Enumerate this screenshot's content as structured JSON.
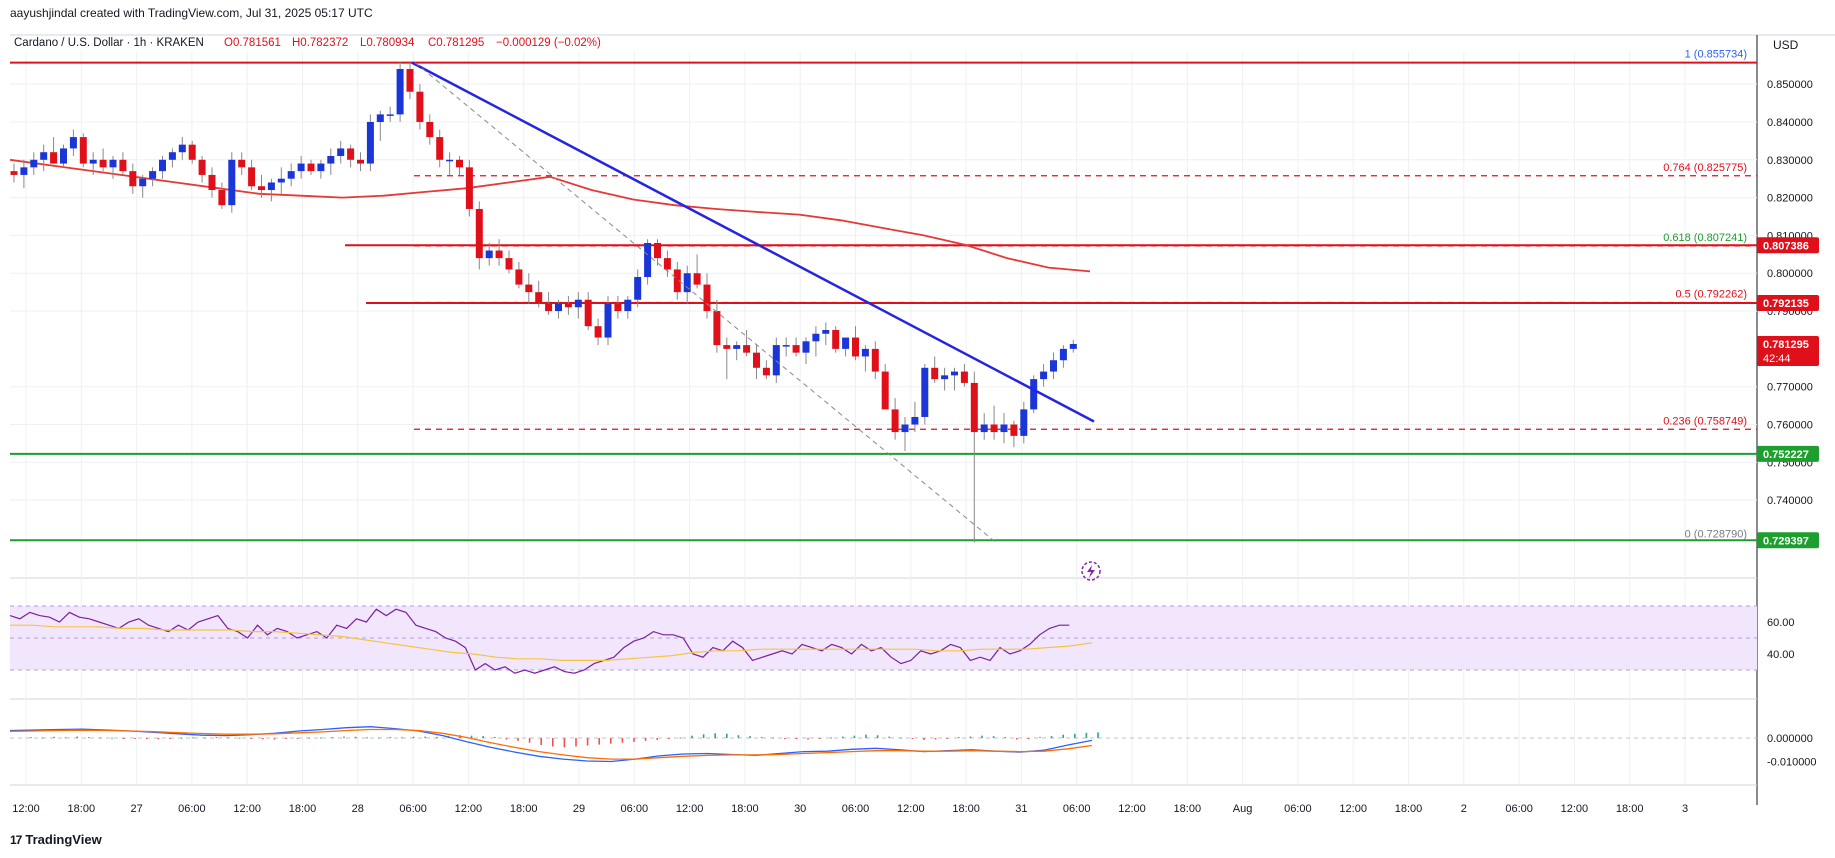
{
  "header": {
    "created_by": "aayushjindal created with TradingView.com, Jul 31, 2025 05:17 UTC"
  },
  "legend": {
    "symbol": "Cardano / U.S. Dollar · 1h · KRAKEN",
    "open": "O0.781561",
    "high": "H0.782372",
    "low": "L0.780934",
    "close": "C0.781295",
    "change": "−0.000129 (−0.02%)"
  },
  "currency": "USD",
  "footer": {
    "brand": "TradingView"
  },
  "colors": {
    "up": "#1a35d8",
    "down": "#e0101a",
    "ma": "#e53935",
    "trend": "#2524e0",
    "support": "#1e9e2e",
    "rsi_bg": "#f1e6fb",
    "rsi": "#7b1fa2",
    "rsi_ma": "#f5c542",
    "macd": "#2962ff",
    "signal": "#ff6d00"
  },
  "chart_data": {
    "type": "candlestick",
    "symbol": "ADAUSD",
    "timeframe": "1h",
    "ylim": [
      0.7255,
      0.8585
    ],
    "y_ticks": [
      "0.850000",
      "0.840000",
      "0.830000",
      "0.820000",
      "0.810000",
      "0.800000",
      "0.790000",
      "0.770000",
      "0.760000",
      "0.750000",
      "0.740000"
    ],
    "x_ticks": [
      "12:00",
      "18:00",
      "27",
      "06:00",
      "12:00",
      "18:00",
      "28",
      "06:00",
      "12:00",
      "18:00",
      "29",
      "06:00",
      "12:00",
      "18:00",
      "30",
      "06:00",
      "12:00",
      "18:00",
      "31",
      "06:00",
      "12:00",
      "18:00",
      "Aug",
      "06:00",
      "12:00",
      "18:00",
      "2",
      "06:00",
      "12:00",
      "18:00",
      "3"
    ],
    "candles_ohlc": [
      [
        0.827,
        0.829,
        0.824,
        0.826
      ],
      [
        0.826,
        0.83,
        0.8225,
        0.828
      ],
      [
        0.828,
        0.832,
        0.826,
        0.83
      ],
      [
        0.83,
        0.834,
        0.827,
        0.832
      ],
      [
        0.832,
        0.836,
        0.829,
        0.829
      ],
      [
        0.829,
        0.834,
        0.828,
        0.833
      ],
      [
        0.833,
        0.838,
        0.831,
        0.836
      ],
      [
        0.836,
        0.837,
        0.828,
        0.829
      ],
      [
        0.829,
        0.832,
        0.826,
        0.83
      ],
      [
        0.83,
        0.833,
        0.827,
        0.828
      ],
      [
        0.828,
        0.831,
        0.825,
        0.83
      ],
      [
        0.83,
        0.832,
        0.826,
        0.827
      ],
      [
        0.827,
        0.829,
        0.821,
        0.823
      ],
      [
        0.823,
        0.826,
        0.82,
        0.825
      ],
      [
        0.825,
        0.828,
        0.823,
        0.827
      ],
      [
        0.827,
        0.831,
        0.825,
        0.83
      ],
      [
        0.83,
        0.833,
        0.828,
        0.832
      ],
      [
        0.832,
        0.836,
        0.83,
        0.834
      ],
      [
        0.834,
        0.835,
        0.829,
        0.83
      ],
      [
        0.83,
        0.831,
        0.824,
        0.826
      ],
      [
        0.826,
        0.828,
        0.82,
        0.822
      ],
      [
        0.822,
        0.824,
        0.817,
        0.818
      ],
      [
        0.818,
        0.832,
        0.816,
        0.83
      ],
      [
        0.83,
        0.832,
        0.826,
        0.828
      ],
      [
        0.828,
        0.83,
        0.822,
        0.823
      ],
      [
        0.823,
        0.826,
        0.82,
        0.822
      ],
      [
        0.822,
        0.825,
        0.819,
        0.824
      ],
      [
        0.824,
        0.828,
        0.821,
        0.825
      ],
      [
        0.825,
        0.829,
        0.823,
        0.827
      ],
      [
        0.827,
        0.831,
        0.825,
        0.829
      ],
      [
        0.829,
        0.83,
        0.826,
        0.827
      ],
      [
        0.827,
        0.83,
        0.825,
        0.829
      ],
      [
        0.829,
        0.833,
        0.826,
        0.831
      ],
      [
        0.831,
        0.835,
        0.829,
        0.833
      ],
      [
        0.833,
        0.834,
        0.828,
        0.83
      ],
      [
        0.83,
        0.832,
        0.827,
        0.829
      ],
      [
        0.829,
        0.842,
        0.827,
        0.84
      ],
      [
        0.84,
        0.843,
        0.835,
        0.842
      ],
      [
        0.842,
        0.844,
        0.84,
        0.842
      ],
      [
        0.842,
        0.856,
        0.84,
        0.854
      ],
      [
        0.854,
        0.8557,
        0.846,
        0.848
      ],
      [
        0.848,
        0.85,
        0.838,
        0.84
      ],
      [
        0.84,
        0.842,
        0.834,
        0.836
      ],
      [
        0.836,
        0.838,
        0.828,
        0.83
      ],
      [
        0.83,
        0.832,
        0.826,
        0.83
      ],
      [
        0.83,
        0.831,
        0.826,
        0.828
      ],
      [
        0.828,
        0.83,
        0.815,
        0.817
      ],
      [
        0.817,
        0.819,
        0.801,
        0.804
      ],
      [
        0.804,
        0.808,
        0.802,
        0.806
      ],
      [
        0.806,
        0.809,
        0.802,
        0.804
      ],
      [
        0.804,
        0.806,
        0.8,
        0.801
      ],
      [
        0.801,
        0.803,
        0.796,
        0.797
      ],
      [
        0.797,
        0.8,
        0.792,
        0.795
      ],
      [
        0.795,
        0.798,
        0.791,
        0.792
      ],
      [
        0.792,
        0.795,
        0.789,
        0.79
      ],
      [
        0.79,
        0.793,
        0.788,
        0.792
      ],
      [
        0.792,
        0.794,
        0.789,
        0.791
      ],
      [
        0.791,
        0.795,
        0.788,
        0.793
      ],
      [
        0.793,
        0.795,
        0.785,
        0.786
      ],
      [
        0.786,
        0.788,
        0.781,
        0.783
      ],
      [
        0.783,
        0.794,
        0.781,
        0.792
      ],
      [
        0.792,
        0.794,
        0.788,
        0.79
      ],
      [
        0.79,
        0.794,
        0.788,
        0.793
      ],
      [
        0.793,
        0.801,
        0.791,
        0.799
      ],
      [
        0.799,
        0.809,
        0.797,
        0.808
      ],
      [
        0.808,
        0.809,
        0.802,
        0.804
      ],
      [
        0.804,
        0.806,
        0.799,
        0.801
      ],
      [
        0.801,
        0.803,
        0.793,
        0.795
      ],
      [
        0.795,
        0.802,
        0.792,
        0.8
      ],
      [
        0.8,
        0.805,
        0.796,
        0.797
      ],
      [
        0.797,
        0.8,
        0.788,
        0.79
      ],
      [
        0.79,
        0.793,
        0.779,
        0.781
      ],
      [
        0.781,
        0.783,
        0.772,
        0.78
      ],
      [
        0.78,
        0.782,
        0.777,
        0.781
      ],
      [
        0.781,
        0.785,
        0.778,
        0.779
      ],
      [
        0.779,
        0.781,
        0.772,
        0.775
      ],
      [
        0.775,
        0.777,
        0.772,
        0.773
      ],
      [
        0.773,
        0.783,
        0.771,
        0.781
      ],
      [
        0.781,
        0.783,
        0.778,
        0.781
      ],
      [
        0.781,
        0.783,
        0.778,
        0.779
      ],
      [
        0.779,
        0.783,
        0.776,
        0.782
      ],
      [
        0.782,
        0.786,
        0.778,
        0.784
      ],
      [
        0.784,
        0.787,
        0.781,
        0.785
      ],
      [
        0.785,
        0.786,
        0.779,
        0.78
      ],
      [
        0.78,
        0.783,
        0.778,
        0.783
      ],
      [
        0.783,
        0.786,
        0.777,
        0.778
      ],
      [
        0.778,
        0.781,
        0.774,
        0.78
      ],
      [
        0.78,
        0.782,
        0.772,
        0.774
      ],
      [
        0.774,
        0.776,
        0.766,
        0.764
      ],
      [
        0.764,
        0.767,
        0.756,
        0.758
      ],
      [
        0.758,
        0.762,
        0.753,
        0.76
      ],
      [
        0.76,
        0.766,
        0.758,
        0.762
      ],
      [
        0.762,
        0.776,
        0.76,
        0.775
      ],
      [
        0.775,
        0.778,
        0.771,
        0.772
      ],
      [
        0.772,
        0.775,
        0.769,
        0.773
      ],
      [
        0.773,
        0.775,
        0.769,
        0.774
      ],
      [
        0.774,
        0.776,
        0.77,
        0.771
      ],
      [
        0.771,
        0.774,
        0.7288,
        0.758
      ],
      [
        0.758,
        0.763,
        0.756,
        0.76
      ],
      [
        0.76,
        0.765,
        0.756,
        0.758
      ],
      [
        0.758,
        0.763,
        0.755,
        0.76
      ],
      [
        0.76,
        0.761,
        0.754,
        0.757
      ],
      [
        0.757,
        0.766,
        0.755,
        0.764
      ],
      [
        0.764,
        0.773,
        0.763,
        0.772
      ],
      [
        0.772,
        0.776,
        0.77,
        0.774
      ],
      [
        0.774,
        0.779,
        0.772,
        0.777
      ],
      [
        0.777,
        0.781,
        0.775,
        0.78
      ],
      [
        0.78,
        0.7824,
        0.779,
        0.7813
      ]
    ],
    "ma_line": [
      0.83,
      0.8285,
      0.827,
      0.8255,
      0.824,
      0.8225,
      0.821,
      0.8205,
      0.82,
      0.8205,
      0.8215,
      0.8225,
      0.824,
      0.8255,
      0.822,
      0.8195,
      0.818,
      0.817,
      0.8162,
      0.8155,
      0.814,
      0.812,
      0.81,
      0.8075,
      0.804,
      0.8015,
      0.8005
    ],
    "fibonacci": [
      {
        "level": "1",
        "price": "0.855734"
      },
      {
        "level": "0.764",
        "price": "0.825775"
      },
      {
        "level": "0.618",
        "price": "0.807241"
      },
      {
        "level": "0.5",
        "price": "0.792262"
      },
      {
        "level": "0.236",
        "price": "0.758749"
      },
      {
        "level": "0",
        "price": "0.728790"
      }
    ],
    "price_tags": [
      {
        "price": 0.807386,
        "label": "0.807386",
        "color": "#e0101a"
      },
      {
        "price": 0.792135,
        "label": "0.792135",
        "color": "#e0101a"
      },
      {
        "price": 0.781295,
        "label": "0.781295",
        "sub": "42:44",
        "color": "#e0101a"
      },
      {
        "price": 0.752227,
        "label": "0.752227",
        "color": "#1e9e2e"
      },
      {
        "price": 0.729397,
        "label": "0.729397",
        "color": "#1e9e2e"
      }
    ],
    "rsi": {
      "ticks": [
        "60.00",
        "40.00"
      ],
      "values": [
        64,
        62,
        66,
        64,
        63,
        60,
        66,
        63,
        62,
        60,
        58,
        56,
        60,
        62,
        58,
        56,
        54,
        58,
        55,
        60,
        62,
        64,
        56,
        54,
        50,
        58,
        52,
        56,
        54,
        50,
        52,
        54,
        50,
        58,
        56,
        62,
        60,
        68,
        64,
        68,
        66,
        58,
        56,
        54,
        50,
        48,
        44,
        30,
        34,
        30,
        32,
        28,
        30,
        28,
        30,
        32,
        29,
        28,
        30,
        34,
        36,
        38,
        44,
        48,
        50,
        54,
        52,
        52,
        50,
        40,
        38,
        44,
        42,
        48,
        44,
        36,
        38,
        40,
        42,
        40,
        46,
        44,
        42,
        46,
        44,
        40,
        46,
        42,
        44,
        38,
        34,
        36,
        42,
        40,
        42,
        46,
        44,
        36,
        38,
        36,
        44,
        40,
        42,
        46,
        52,
        56,
        58,
        58
      ],
      "ma": [
        58,
        58,
        57,
        57,
        57,
        56,
        56,
        55,
        55,
        55,
        55,
        54,
        54,
        53,
        52,
        51,
        49,
        47,
        45,
        43,
        41,
        40,
        38,
        37,
        37,
        36,
        36,
        36,
        37,
        38,
        39,
        41,
        42,
        42,
        43,
        43,
        43,
        43,
        43,
        43,
        43,
        43,
        42,
        42,
        43,
        43,
        43,
        44,
        45,
        47
      ]
    },
    "macd": {
      "ticks": [
        "0.000000",
        "-0.010000"
      ],
      "hist": [
        0.0004,
        0.0002,
        0.0005,
        0.0003,
        0.0006,
        0.0004,
        0.0002,
        0.0001,
        -0.0002,
        -0.0004,
        -0.0003,
        -0.0005,
        -0.0002,
        0.0001,
        0.0003,
        0.0002,
        0.0004,
        0.0003,
        0.0001,
        -0.0002,
        -0.0005,
        -0.0006,
        -0.0003,
        -0.0002,
        0.0001,
        0.0002,
        0.0004,
        0.0006,
        0.0005,
        0.0003,
        0.0002,
        0.0004,
        0.0003,
        0.0005,
        0.0006,
        0.0004,
        0.0008,
        0.0012,
        0.001,
        0.0008,
        0.0004,
        -0.0006,
        -0.0012,
        -0.002,
        -0.003,
        -0.0036,
        -0.004,
        -0.0036,
        -0.0032,
        -0.0028,
        -0.0024,
        -0.002,
        -0.0016,
        -0.0012,
        -0.0008,
        -0.0004,
        0.0002,
        0.001,
        0.0016,
        0.002,
        0.0018,
        0.0012,
        0.0008,
        0.0004,
        0.0002,
        -0.0002,
        -0.0004,
        -0.0006,
        -0.0002,
        0.0002,
        0.0006,
        0.001,
        0.0014,
        0.0012,
        0.0006,
        0.0002,
        -0.0004,
        -0.0008,
        -0.0006,
        -0.0002,
        0.0004,
        0.0006,
        0.001,
        0.0008,
        0.0004,
        -0.0006,
        -0.0002,
        0.0004,
        0.0008,
        0.0014,
        0.0018,
        0.0022,
        0.0024
      ],
      "macd_line": [
        0.0032,
        0.0034,
        0.0036,
        0.0038,
        0.0034,
        0.003,
        0.0024,
        0.0018,
        0.0012,
        0.001,
        0.0014,
        0.002,
        0.003,
        0.0036,
        0.0044,
        0.0048,
        0.004,
        0.003,
        0.001,
        -0.0016,
        -0.004,
        -0.006,
        -0.0078,
        -0.009,
        -0.0098,
        -0.01,
        -0.009,
        -0.0076,
        -0.0068,
        -0.0066,
        -0.007,
        -0.0074,
        -0.0066,
        -0.0058,
        -0.0056,
        -0.0048,
        -0.0044,
        -0.005,
        -0.0058,
        -0.0054,
        -0.005,
        -0.0056,
        -0.006,
        -0.0052,
        -0.003,
        -0.001
      ],
      "signal_line": [
        0.0028,
        0.003,
        0.0032,
        0.0033,
        0.0032,
        0.003,
        0.0027,
        0.0023,
        0.0019,
        0.0016,
        0.0016,
        0.0018,
        0.0022,
        0.0026,
        0.0032,
        0.0036,
        0.0036,
        0.0032,
        0.002,
        0.0002,
        -0.002,
        -0.004,
        -0.0058,
        -0.0072,
        -0.0084,
        -0.009,
        -0.009,
        -0.0084,
        -0.0078,
        -0.0074,
        -0.0072,
        -0.0072,
        -0.007,
        -0.0066,
        -0.0062,
        -0.0058,
        -0.0054,
        -0.0054,
        -0.0056,
        -0.0056,
        -0.0054,
        -0.0056,
        -0.0058,
        -0.0056,
        -0.0046,
        -0.0032
      ]
    }
  }
}
